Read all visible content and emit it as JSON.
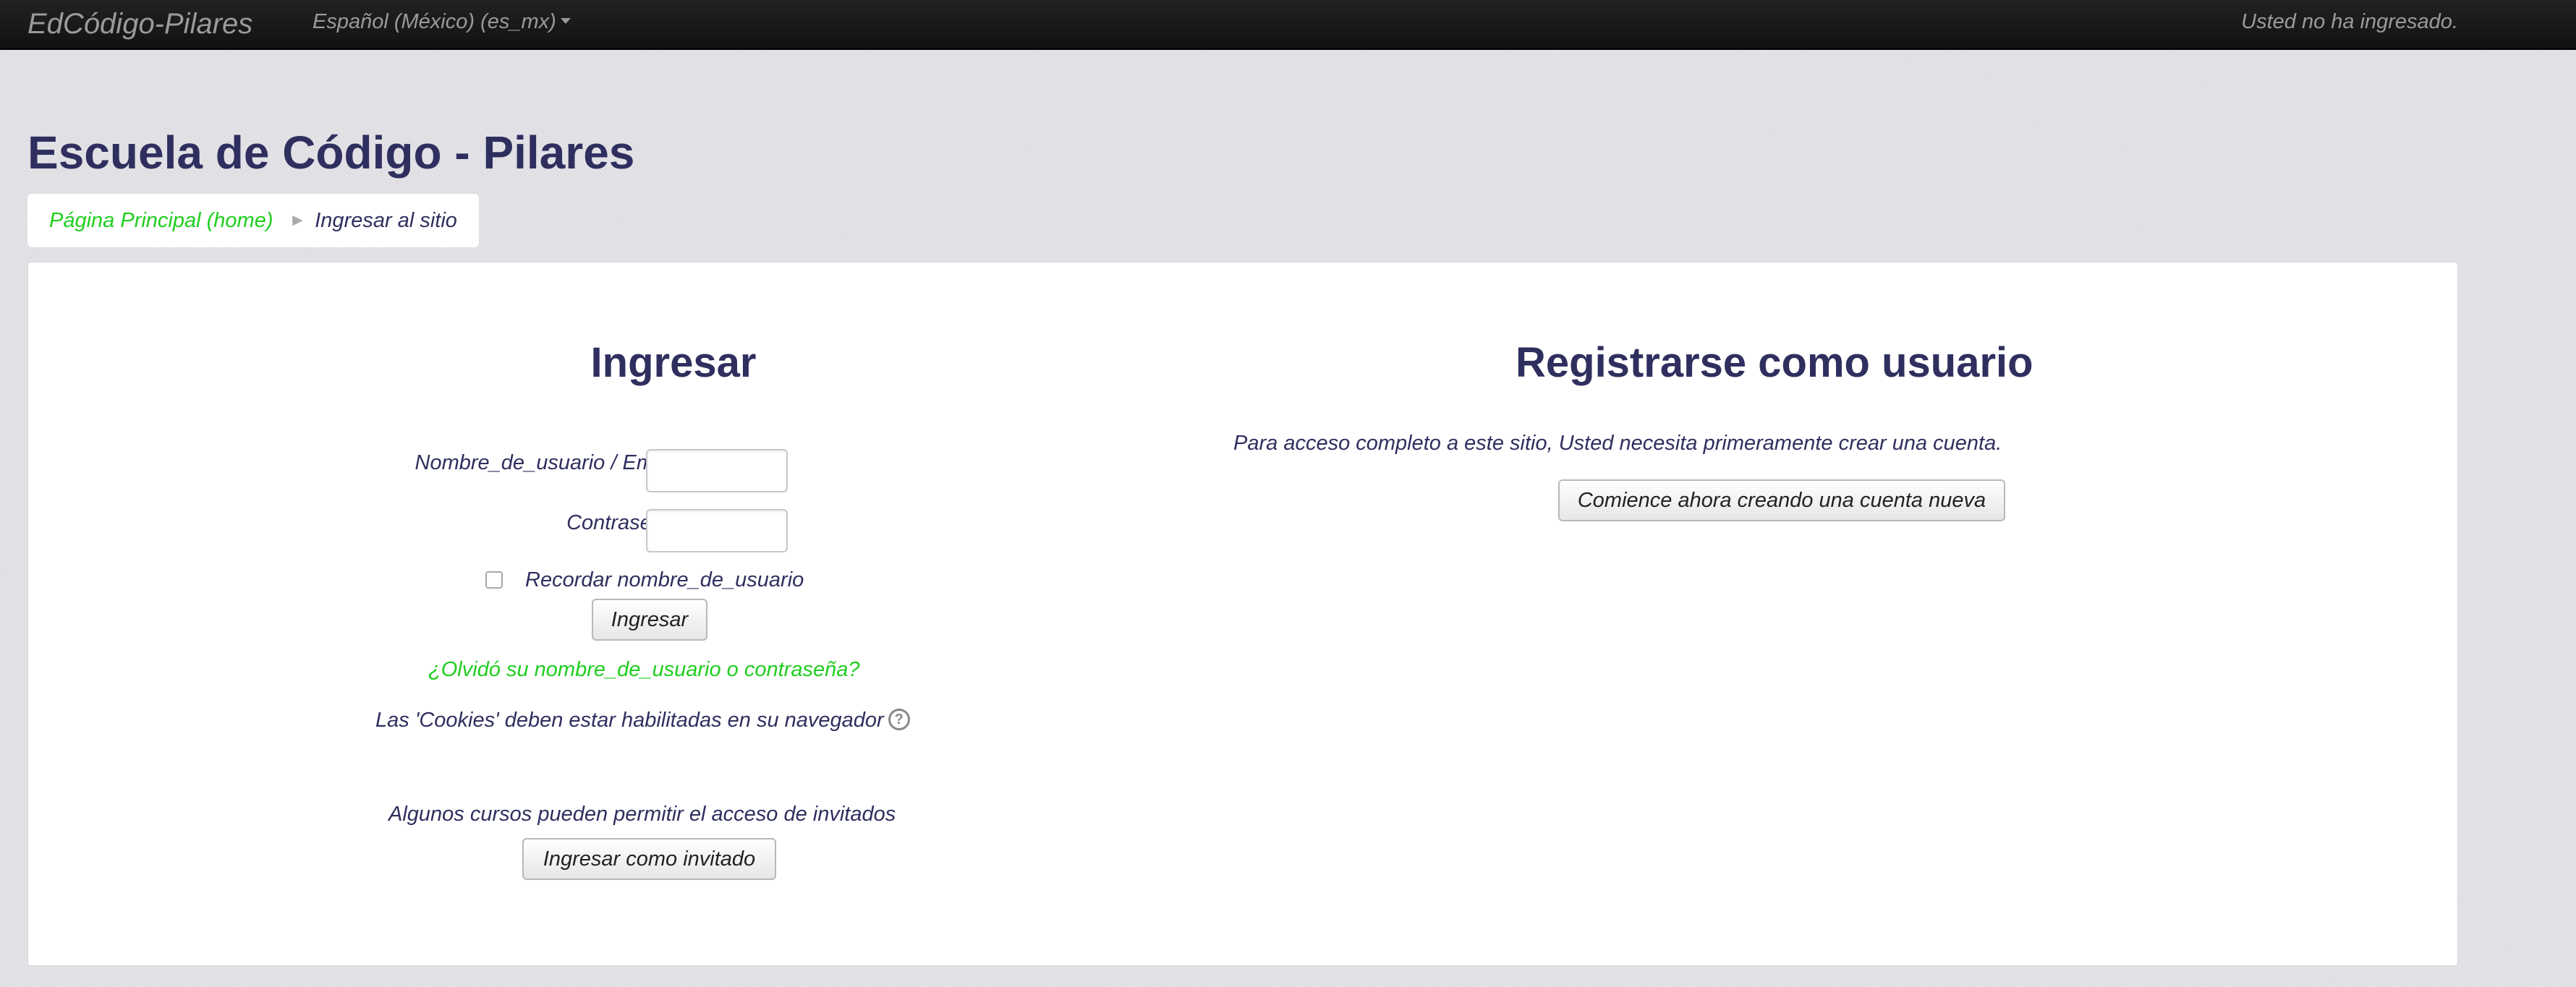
{
  "navbar": {
    "brand": "EdCódigo-Pilares",
    "language": "Español (México) (es_mx)",
    "login_status": "Usted no ha ingresado."
  },
  "page": {
    "title": "Escuela de Código - Pilares"
  },
  "breadcrumb": {
    "home": "Página Principal (home)",
    "separator": "►",
    "current": "Ingresar al sitio"
  },
  "login": {
    "heading": "Ingresar",
    "username_label": "Nombre_de_usuario / Email",
    "username_value": "",
    "password_label": "Contraseña",
    "password_value": "",
    "remember_label": "Recordar nombre_de_usuario",
    "remember_checked": false,
    "submit_label": "Ingresar",
    "forgot_link": "¿Olvidó su nombre_de_usuario o contraseña?",
    "cookies_notice": "Las 'Cookies' deben estar habilitadas en su navegador",
    "help_icon": "question-circle-icon",
    "guest_notice": "Algunos cursos pueden permitir el acceso de invitados",
    "guest_button": "Ingresar como invitado"
  },
  "signup": {
    "heading": "Registrarse como usuario",
    "notice": "Para acceso completo a este sitio, Usted necesita primeramente crear una cuenta.",
    "button": "Comience ahora creando una cuenta nueva"
  },
  "colors": {
    "title": "#2f2f5f",
    "link": "#1fce1f",
    "navbar": "#1a1a1a",
    "background": "#e1e1e6"
  }
}
